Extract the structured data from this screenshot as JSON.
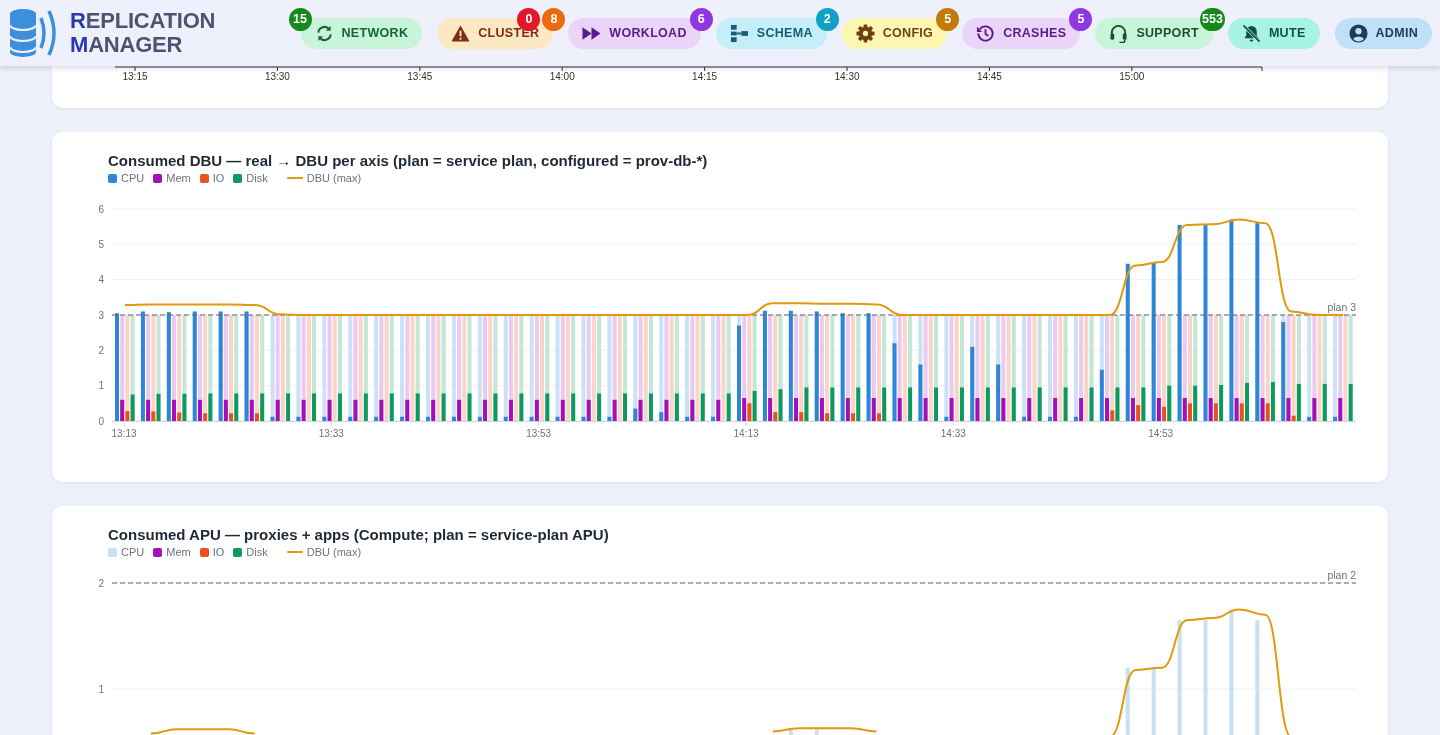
{
  "header": {
    "logo_lines": [
      "REPLICATION",
      "MANAGER"
    ],
    "nav": [
      {
        "kind": "network",
        "label": "NETWORK",
        "badges": [
          {
            "text": "15",
            "color": "#15891b"
          }
        ]
      },
      {
        "kind": "cluster",
        "label": "CLUSTER",
        "badges": [
          {
            "text": "0",
            "color": "#e5172a"
          },
          {
            "text": "8",
            "color": "#ea6a0c"
          }
        ]
      },
      {
        "kind": "workload",
        "label": "WORKLOAD",
        "badges": [
          {
            "text": "6",
            "color": "#9137e0"
          }
        ]
      },
      {
        "kind": "schema",
        "label": "SCHEMA",
        "badges": [
          {
            "text": "2",
            "color": "#0fa2c4"
          }
        ]
      },
      {
        "kind": "config",
        "label": "CONFIG",
        "badges": [
          {
            "text": "5",
            "color": "#c27a0c"
          }
        ]
      },
      {
        "kind": "crashes",
        "label": "CRASHES",
        "badges": [
          {
            "text": "5",
            "color": "#9137e0"
          }
        ]
      },
      {
        "kind": "support",
        "label": "SUPPORT",
        "badges": [
          {
            "text": "553",
            "color": "#15891b"
          }
        ]
      },
      {
        "kind": "mute",
        "label": "MUTE"
      },
      {
        "kind": "admin",
        "label": "ADMIN"
      }
    ]
  },
  "timeline_axis": {
    "labels": [
      "13:15",
      "13:30",
      "13:45",
      "14:00",
      "14:15",
      "14:30",
      "14:45",
      "15:00"
    ]
  },
  "charts": [
    {
      "title": "Consumed DBU — real → DBU per axis (plan = service plan, configured = prov-db-*)",
      "show_configured": true,
      "chart_data": {
        "type": "bar",
        "categories": [
          "13:13",
          null,
          null,
          null,
          null,
          null,
          null,
          null,
          "13:33",
          null,
          null,
          null,
          null,
          null,
          null,
          null,
          "13:53",
          null,
          null,
          null,
          null,
          null,
          null,
          null,
          "14:13",
          null,
          null,
          null,
          null,
          null,
          null,
          null,
          "14:33",
          null,
          null,
          null,
          null,
          null,
          null,
          null,
          "14:53",
          null,
          null,
          null,
          null,
          null,
          null,
          null
        ],
        "series": [
          {
            "name": "CPU",
            "color": "#2f86d6",
            "values": [
              3.05,
              3.1,
              3.08,
              3.1,
              3.1,
              3.1,
              0.12,
              0.12,
              0.12,
              0.12,
              0.12,
              0.12,
              0.12,
              0.12,
              0.12,
              0.12,
              0.12,
              0.12,
              0.12,
              0.12,
              0.35,
              0.25,
              0.12,
              0.12,
              2.7,
              3.12,
              3.12,
              3.1,
              3.05,
              3.05,
              2.2,
              1.6,
              0.12,
              2.1,
              1.6,
              0.12,
              0.12,
              0.12,
              1.45,
              4.45,
              4.5,
              5.55,
              5.55,
              5.7,
              5.6,
              2.8,
              0.12,
              0.12
            ]
          },
          {
            "name": "Mem",
            "color": "#a30fb8",
            "values": [
              0.6,
              0.6,
              0.6,
              0.6,
              0.6,
              0.6,
              0.6,
              0.6,
              0.6,
              0.6,
              0.6,
              0.6,
              0.6,
              0.6,
              0.6,
              0.6,
              0.6,
              0.6,
              0.6,
              0.6,
              0.6,
              0.6,
              0.6,
              0.6,
              0.65,
              0.65,
              0.65,
              0.65,
              0.65,
              0.65,
              0.65,
              0.65,
              0.65,
              0.65,
              0.65,
              0.65,
              0.65,
              0.65,
              0.65,
              0.65,
              0.65,
              0.65,
              0.65,
              0.65,
              0.65,
              0.65,
              0.65,
              0.65
            ]
          },
          {
            "name": "IO",
            "color": "#e8531d",
            "values": [
              0.28,
              0.27,
              0.24,
              0.22,
              0.22,
              0.22,
              0,
              0,
              0,
              0,
              0,
              0,
              0,
              0,
              0,
              0,
              0,
              0,
              0,
              0,
              0,
              0,
              0,
              0,
              0.5,
              0.25,
              0.25,
              0.22,
              0.22,
              0.22,
              0,
              0,
              0,
              0,
              0,
              0,
              0,
              0,
              0.3,
              0.45,
              0.4,
              0.5,
              0.5,
              0.5,
              0.5,
              0.15,
              0,
              0
            ]
          },
          {
            "name": "Disk",
            "color": "#0e9a5f",
            "values": [
              0.75,
              0.77,
              0.77,
              0.78,
              0.78,
              0.78,
              0.78,
              0.78,
              0.78,
              0.78,
              0.78,
              0.78,
              0.78,
              0.78,
              0.78,
              0.78,
              0.78,
              0.78,
              0.78,
              0.78,
              0.78,
              0.78,
              0.78,
              0.78,
              0.85,
              0.9,
              0.95,
              0.95,
              0.95,
              0.95,
              0.95,
              0.95,
              0.95,
              0.95,
              0.95,
              0.95,
              0.95,
              0.95,
              0.95,
              0.95,
              1.0,
              1.0,
              1.02,
              1.08,
              1.1,
              1.05,
              1.05,
              1.05
            ]
          },
          {
            "name": "DBU (max)",
            "color": "#e09a0c",
            "type": "line",
            "values": [
              3.28,
              3.3,
              3.3,
              3.3,
              3.3,
              3.28,
              3.02,
              3.0,
              3.0,
              3.0,
              3.0,
              3.0,
              3.0,
              3.0,
              3.0,
              3.0,
              3.0,
              3.0,
              3.0,
              3.0,
              3.0,
              3.0,
              3.0,
              3.0,
              3.0,
              3.33,
              3.33,
              3.32,
              3.32,
              3.3,
              3.0,
              3.0,
              3.0,
              3.0,
              3.0,
              3.0,
              3.0,
              3.0,
              3.0,
              4.4,
              4.5,
              5.55,
              5.57,
              5.7,
              5.6,
              3.1,
              3.0,
              3.0
            ]
          }
        ],
        "ylim": [
          0,
          6
        ],
        "yticks": [
          0,
          1,
          2,
          3,
          4,
          5,
          6
        ],
        "grid": true,
        "ref_lines": [
          {
            "axis": "y",
            "value": 3,
            "label": "plan 3"
          }
        ]
      }
    },
    {
      "title": "Consumed APU — proxies + apps (Compute; plan = service-plan APU)",
      "chart_data": {
        "type": "bar",
        "series": [
          {
            "name": "CPU",
            "color": "#c9dff2",
            "values": [
              null,
              null,
              null,
              null,
              null,
              null,
              null,
              null,
              null,
              null,
              null,
              null,
              null,
              null,
              null,
              null,
              null,
              null,
              null,
              null,
              null,
              null,
              null,
              null,
              null,
              null,
              0.62,
              0.62,
              null,
              null,
              null,
              null,
              null,
              null,
              null,
              null,
              null,
              null,
              null,
              1.2,
              1.2,
              1.65,
              1.65,
              1.75,
              1.65,
              null,
              null,
              null
            ]
          },
          {
            "name": "Mem",
            "color": "#a30fb8",
            "values": [
              null,
              null,
              null,
              null,
              null,
              null,
              null,
              null,
              null,
              null,
              null,
              null,
              null,
              null,
              null,
              null,
              null,
              null,
              null,
              null,
              null,
              null,
              null,
              null,
              null,
              null,
              null,
              null,
              null,
              null,
              null,
              null,
              null,
              null,
              null,
              null,
              null,
              null,
              null,
              null,
              null,
              null,
              null,
              null,
              null,
              null,
              null,
              null
            ]
          },
          {
            "name": "IO",
            "color": "#e8531d",
            "values": [
              null,
              null,
              null,
              null,
              null,
              null,
              null,
              null,
              null,
              null,
              null,
              null,
              null,
              null,
              null,
              null,
              null,
              null,
              null,
              null,
              null,
              null,
              null,
              null,
              null,
              null,
              null,
              null,
              null,
              null,
              null,
              null,
              null,
              null,
              null,
              null,
              null,
              null,
              null,
              null,
              null,
              null,
              null,
              null,
              null,
              null,
              null,
              null
            ]
          },
          {
            "name": "Disk",
            "color": "#0e9a5f",
            "values": [
              null,
              null,
              null,
              null,
              null,
              null,
              null,
              null,
              null,
              null,
              null,
              null,
              null,
              null,
              null,
              null,
              null,
              null,
              null,
              null,
              null,
              null,
              null,
              null,
              null,
              null,
              null,
              null,
              null,
              null,
              null,
              null,
              null,
              null,
              null,
              null,
              null,
              null,
              null,
              null,
              null,
              null,
              null,
              null,
              null,
              null,
              null,
              null
            ]
          },
          {
            "name": "DBU (max)",
            "color": "#e09a0c",
            "type": "line",
            "values": [
              null,
              0.58,
              0.62,
              0.62,
              0.62,
              0.58,
              null,
              null,
              null,
              null,
              null,
              null,
              null,
              null,
              null,
              null,
              null,
              null,
              null,
              null,
              null,
              null,
              null,
              null,
              null,
              0.6,
              0.63,
              0.63,
              0.63,
              0.6,
              null,
              null,
              null,
              null,
              null,
              null,
              null,
              null,
              0.55,
              1.18,
              1.2,
              1.65,
              1.67,
              1.75,
              1.7,
              0.55,
              null,
              null
            ]
          }
        ],
        "ylim": [
          0,
          2
        ],
        "yticks": [
          1,
          2
        ],
        "grid": true,
        "ref_lines": [
          {
            "axis": "y",
            "value": 2,
            "label": "plan 2"
          }
        ]
      }
    }
  ]
}
